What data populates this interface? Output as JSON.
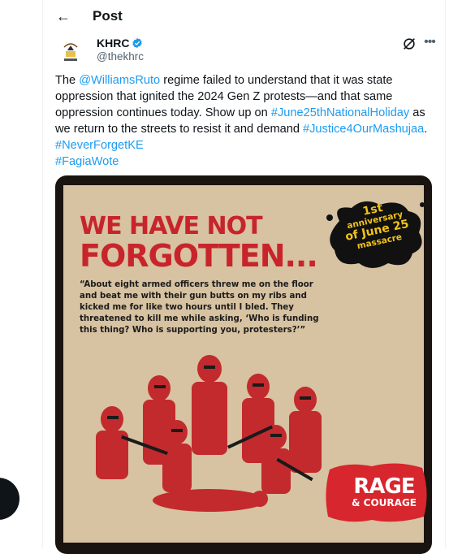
{
  "header": {
    "back_label": "←",
    "title": "Post"
  },
  "author": {
    "name": "KHRC",
    "handle": "@thekhrc"
  },
  "tweet": {
    "t1": "The ",
    "mention": "@WilliamsRuto",
    "t2": " regime failed to understand that it was state oppression that ignited the 2024 Gen Z protests—and that same oppression continues today. Show up on ",
    "tag1": "#June25thNationalHoliday",
    "t3": " as we return to the streets to resist it and demand ",
    "tag2": "#Justice4OurMashujaa",
    "t4": ".",
    "tag3": "#NeverForgetKE",
    "tag4": "#FagiaWote"
  },
  "poster": {
    "headline_1": "WE HAVE NOT",
    "headline_2": "FORGOTTEN...",
    "quote": "“About eight armed officers threw me on the floor and beat me with their gun butts on my ribs and kicked me for like two hours until I bled. They threatened to kill me while asking, ‘Who is funding this thing? Who is supporting you, protesters?’”",
    "badge_1": "1st",
    "badge_2": "anniversary",
    "badge_3": "of June 25",
    "badge_4": "massacre",
    "rage_1": "RAGE",
    "rage_2": "& COURAGE"
  },
  "colors": {
    "link": "#1d9bf0",
    "poster_red": "#c8242b",
    "paper": "#d7c2a1",
    "badge_text": "#f1c319"
  },
  "icons": [
    "back-arrow-icon",
    "verified-badge-icon",
    "grok-icon",
    "more-icon"
  ]
}
